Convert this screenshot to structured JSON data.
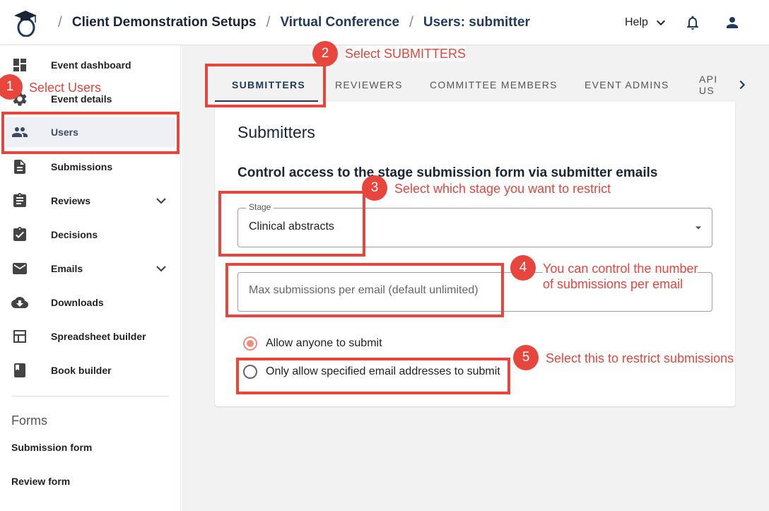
{
  "breadcrumb": {
    "items": [
      "Client Demonstration Setups",
      "Virtual Conference",
      "Users: submitter"
    ],
    "separator": "/"
  },
  "header": {
    "help_label": "Help"
  },
  "sidebar": {
    "items": [
      {
        "label": "Event dashboard",
        "icon": "dashboard-icon"
      },
      {
        "label": "Event details",
        "icon": "gear-icon"
      },
      {
        "label": "Users",
        "icon": "people-icon",
        "active": true
      },
      {
        "label": "Submissions",
        "icon": "document-icon"
      },
      {
        "label": "Reviews",
        "icon": "clipboard-icon",
        "expandable": true
      },
      {
        "label": "Decisions",
        "icon": "clipboard-check-icon"
      },
      {
        "label": "Emails",
        "icon": "mail-icon",
        "expandable": true
      },
      {
        "label": "Downloads",
        "icon": "cloud-download-icon"
      },
      {
        "label": "Spreadsheet builder",
        "icon": "table-icon"
      },
      {
        "label": "Book builder",
        "icon": "book-icon"
      }
    ],
    "forms_heading": "Forms",
    "forms": [
      "Submission form",
      "Review form"
    ]
  },
  "tabs": [
    "SUBMITTERS",
    "REVIEWERS",
    "COMMITTEE MEMBERS",
    "EVENT ADMINS",
    "API US"
  ],
  "card": {
    "title": "Submitters",
    "section_title": "Control access to the stage submission form via submitter emails",
    "stage_label": "Stage",
    "stage_value": "Clinical abstracts",
    "max_placeholder": "Max submissions per email (default unlimited)",
    "radio_options": [
      {
        "label": "Allow anyone to submit",
        "checked": true
      },
      {
        "label": "Only allow specified email addresses to submit",
        "checked": false
      }
    ]
  },
  "annotations": [
    {
      "num": "1",
      "text": "Select Users"
    },
    {
      "num": "2",
      "text": "Select SUBMITTERS"
    },
    {
      "num": "3",
      "text": "Select which stage you want to restrict"
    },
    {
      "num": "4",
      "text_line1": "You can control the number",
      "text_line2": "of submissions per email"
    },
    {
      "num": "5",
      "text": "Select this to restrict submissions"
    }
  ],
  "colors": {
    "annotation": "#e8453c",
    "primary": "#1f3a5f",
    "radio_accent": "#f08c7a"
  }
}
